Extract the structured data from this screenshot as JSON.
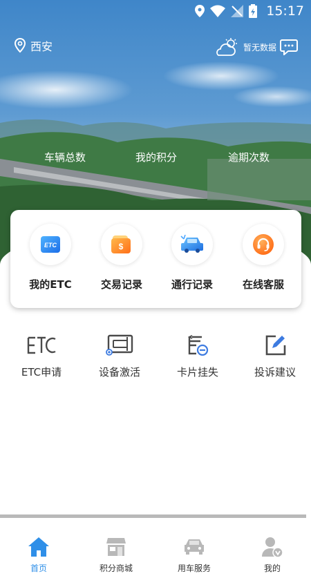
{
  "status_bar": {
    "time": "15:17"
  },
  "header": {
    "location": "西安",
    "weather_text": "暂无数据"
  },
  "stats": [
    {
      "label": "车辆总数"
    },
    {
      "label": "我的积分"
    },
    {
      "label": "逾期次数"
    }
  ],
  "quick_actions": [
    {
      "label": "我的ETC",
      "icon": "etc-card-icon"
    },
    {
      "label": "交易记录",
      "icon": "wallet-icon"
    },
    {
      "label": "通行记录",
      "icon": "car-icon"
    },
    {
      "label": "在线客服",
      "icon": "headset-icon"
    }
  ],
  "services": [
    {
      "label": "ETC申请",
      "icon": "etc-text-icon"
    },
    {
      "label": "设备激活",
      "icon": "device-icon"
    },
    {
      "label": "卡片挂失",
      "icon": "card-lost-icon"
    },
    {
      "label": "投诉建议",
      "icon": "edit-icon"
    }
  ],
  "tabs": [
    {
      "label": "首页",
      "icon": "home-icon",
      "active": true
    },
    {
      "label": "积分商城",
      "icon": "store-icon",
      "active": false
    },
    {
      "label": "用车服务",
      "icon": "car-service-icon",
      "active": false
    },
    {
      "label": "我的",
      "icon": "profile-icon",
      "active": false
    }
  ],
  "colors": {
    "accent": "#2f8fe8",
    "tab_inactive": "#b8b8b8"
  }
}
